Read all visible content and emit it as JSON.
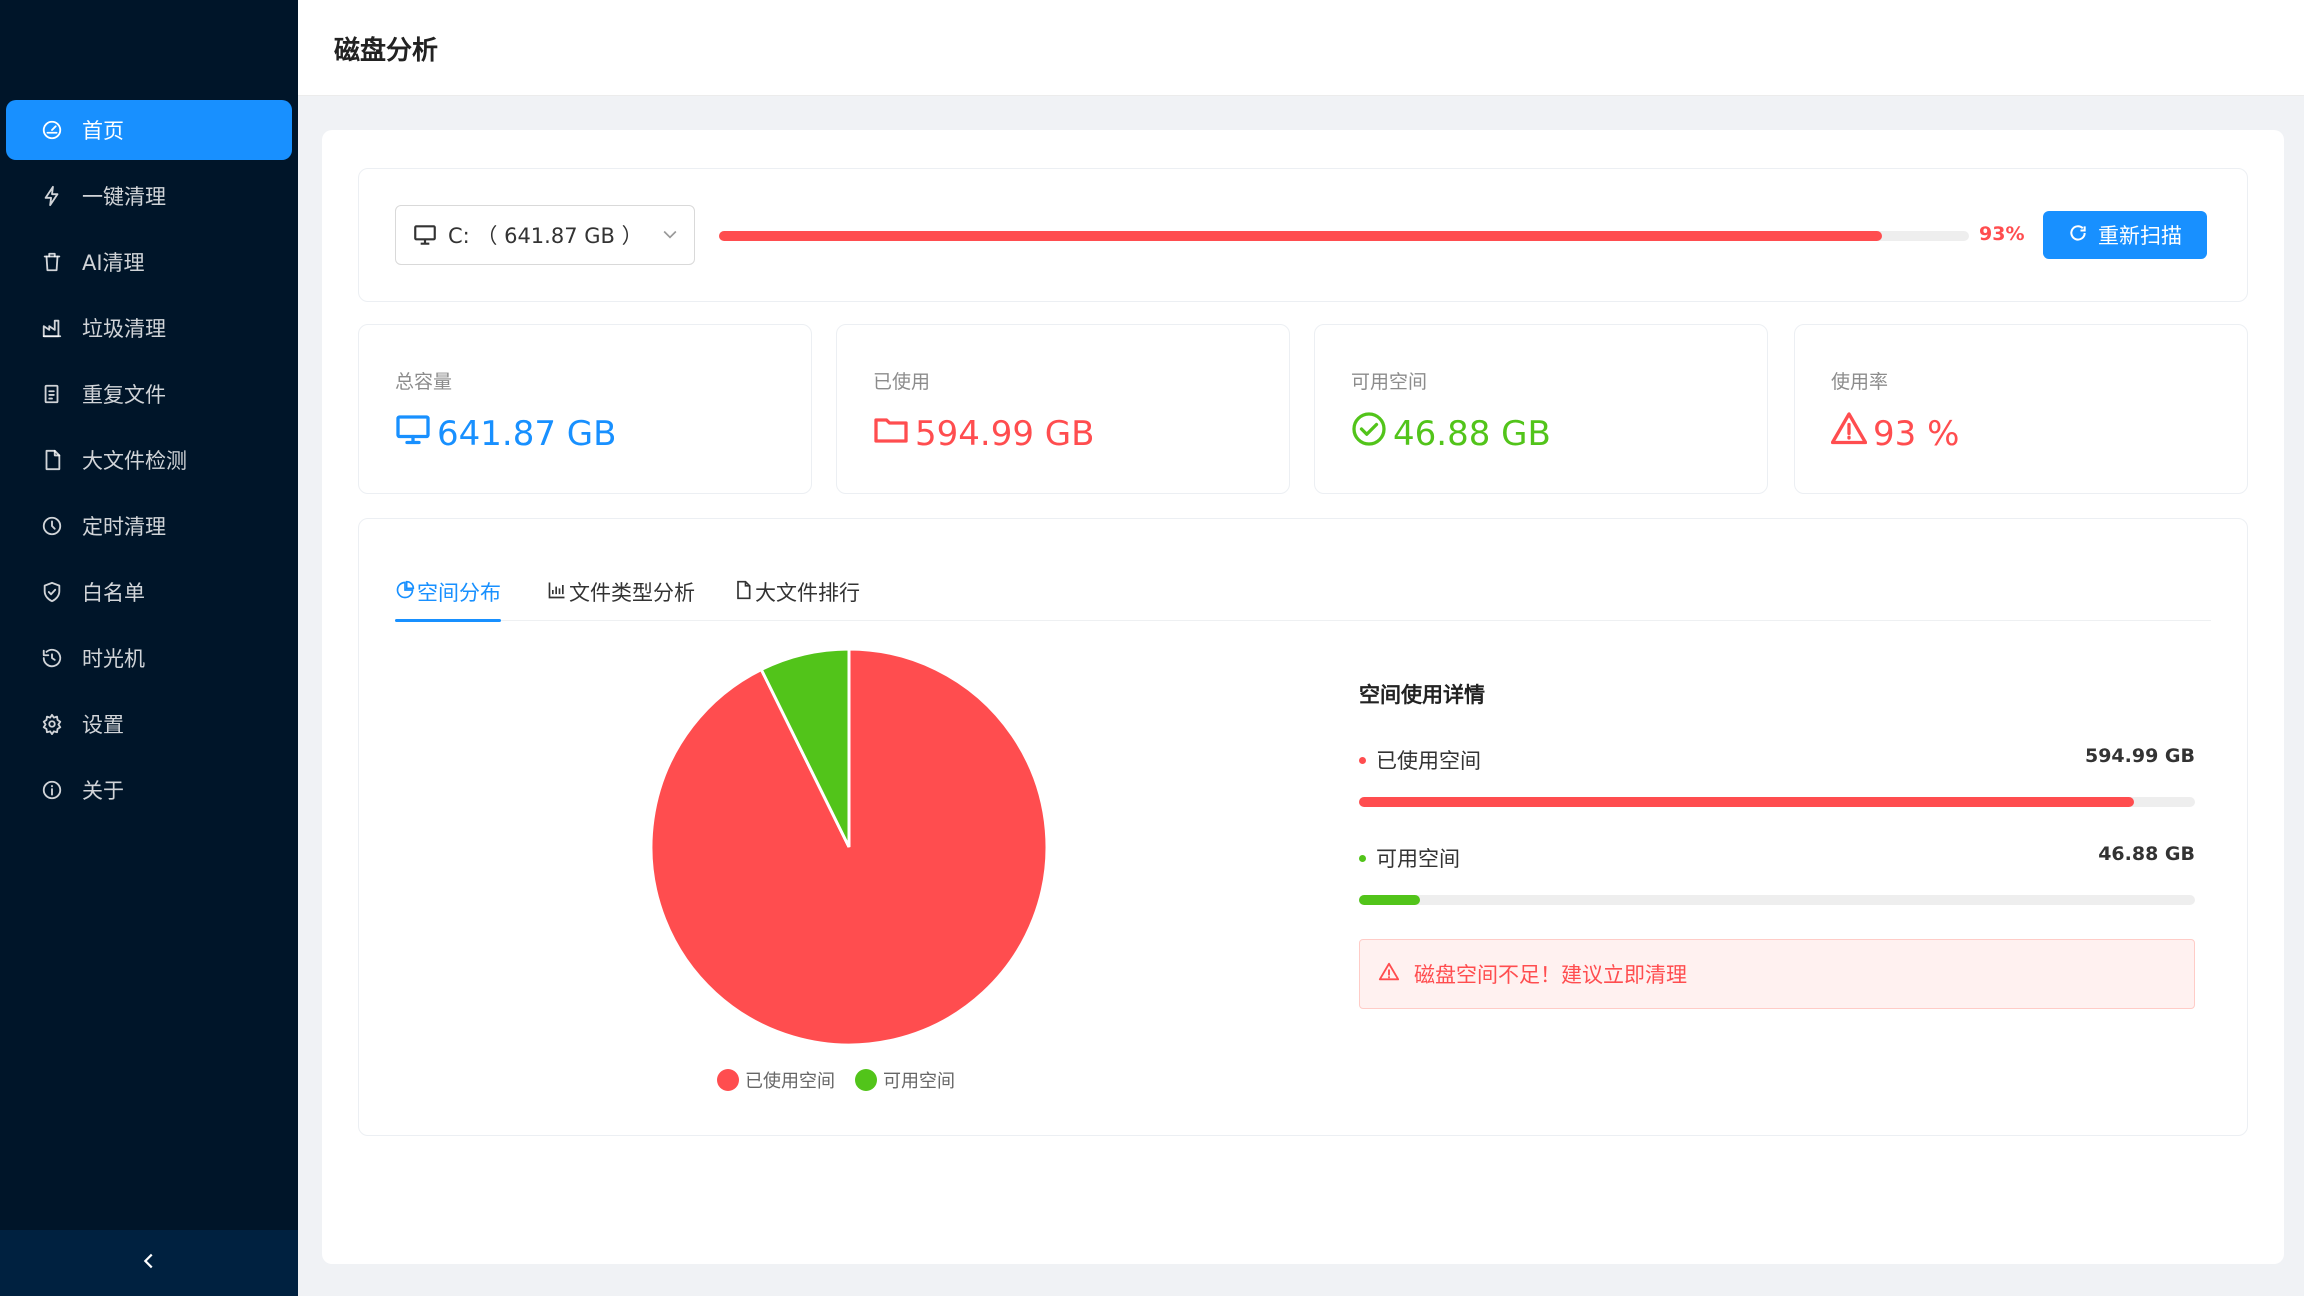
{
  "page_title": "磁盘分析",
  "sidebar": {
    "items": [
      {
        "label": "首页",
        "icon": "dashboard-icon",
        "active": true
      },
      {
        "label": "一键清理",
        "icon": "lightning-icon"
      },
      {
        "label": "AI清理",
        "icon": "trash-icon"
      },
      {
        "label": "垃圾清理",
        "icon": "factory-icon"
      },
      {
        "label": "重复文件",
        "icon": "copy-file-icon"
      },
      {
        "label": "大文件检测",
        "icon": "file-icon"
      },
      {
        "label": "定时清理",
        "icon": "clock-icon"
      },
      {
        "label": "白名单",
        "icon": "shield-check-icon"
      },
      {
        "label": "时光机",
        "icon": "history-icon"
      },
      {
        "label": "设置",
        "icon": "gear-icon"
      },
      {
        "label": "关于",
        "icon": "info-icon"
      }
    ]
  },
  "toolbar": {
    "drive_select": "C: （ 641.87 GB ）",
    "usage_percent": 93,
    "usage_percent_label": "93%",
    "rescan_label": "重新扫描"
  },
  "stats": {
    "total": {
      "label": "总容量",
      "value": "641.87 GB"
    },
    "used": {
      "label": "已使用",
      "value": "594.99 GB"
    },
    "free": {
      "label": "可用空间",
      "value": "46.88 GB"
    },
    "rate": {
      "label": "使用率",
      "value": "93 %"
    }
  },
  "tabs": [
    "空间分布",
    "文件类型分析",
    "大文件排行"
  ],
  "chart_data": {
    "type": "pie",
    "series": [
      {
        "name": "已使用空间",
        "value": 594.99,
        "color": "#ff4d4f"
      },
      {
        "name": "可用空间",
        "value": 46.88,
        "color": "#52c41a"
      }
    ]
  },
  "detail": {
    "title": "空间使用详情",
    "used_label": "已使用空间",
    "used_value": "594.99 GB",
    "used_fraction": 0.927,
    "free_label": "可用空间",
    "free_value": "46.88 GB",
    "free_fraction": 0.073,
    "warning": "磁盘空间不足！建议立即清理"
  },
  "colors": {
    "primary": "#1890ff",
    "danger": "#ff4d4f",
    "success": "#52c41a",
    "sidebar": "#001529"
  }
}
